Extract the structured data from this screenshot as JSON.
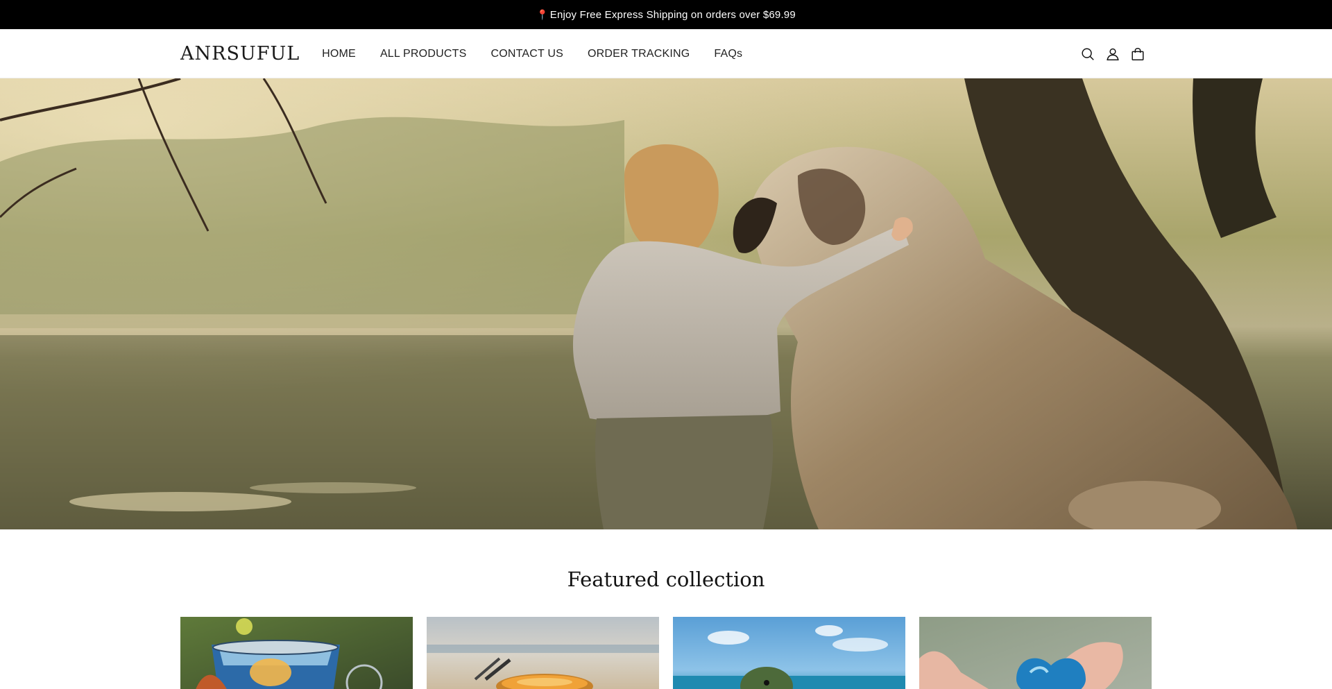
{
  "announcement": {
    "pin_icon": "pin-icon",
    "text": "Enjoy Free Express Shipping on orders over $69.99"
  },
  "header": {
    "logo": "ANRSUFUL",
    "nav": [
      {
        "label": "HOME"
      },
      {
        "label": "ALL PRODUCTS"
      },
      {
        "label": "CONTACT US"
      },
      {
        "label": "ORDER TRACKING"
      },
      {
        "label": "FAQs"
      }
    ],
    "icons": [
      "search-icon",
      "account-icon",
      "cart-icon"
    ]
  },
  "hero": {
    "image": "child-with-dog-by-lake"
  },
  "featured": {
    "title": "Featured collection",
    "products": [
      {
        "image": "blue-glass-candle-holder"
      },
      {
        "image": "amber-candle-on-beach"
      },
      {
        "image": "sea-turtle-figurine"
      },
      {
        "image": "blue-glass-heart"
      }
    ]
  },
  "colors": {
    "announcement_bg": "#000000",
    "announcement_text": "#ffffff",
    "text": "#121212"
  }
}
